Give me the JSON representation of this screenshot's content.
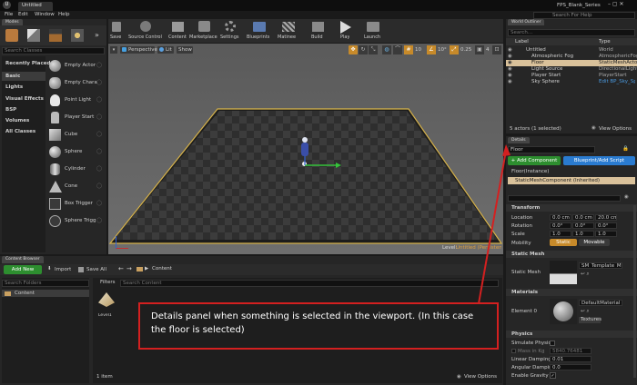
{
  "window": {
    "title": "Untitled",
    "project": "FPS_Blank_Series",
    "search_help": "Search For Help"
  },
  "menu": [
    "File",
    "Edit",
    "Window",
    "Help"
  ],
  "modes": {
    "title": "Modes",
    "search_placeholder": "Search Classes",
    "categories": [
      "Recently Placed",
      "Basic",
      "Lights",
      "Visual Effects",
      "BSP",
      "Volumes",
      "All Classes"
    ],
    "items": [
      "Empty Actor",
      "Empty Chara",
      "Point Light",
      "Player Start",
      "Cube",
      "Sphere",
      "Cylinder",
      "Cone",
      "Box Trigger",
      "Sphere Trigg"
    ]
  },
  "toolbar": [
    "Save",
    "Source Control",
    "Content",
    "Marketplace",
    "Settings",
    "Blueprints",
    "Matinee",
    "Build",
    "Play",
    "Launch"
  ],
  "viewport": {
    "perspective": "Perspective",
    "lit": "Lit",
    "show": "Show",
    "grid_snap": "10",
    "angle_snap": "10°",
    "scale_snap": "0.25",
    "cam_speed": "4",
    "level_label": "Level:",
    "level_name": "Untitled (Persistent)"
  },
  "outliner": {
    "title": "World Outliner",
    "search_placeholder": "Search...",
    "col_label": "Label",
    "col_type": "Type",
    "rows": [
      {
        "label": "Untitled",
        "type": "World"
      },
      {
        "label": "Atmospheric Fog",
        "type": "AtmosphericFog"
      },
      {
        "label": "Floor",
        "type": "StaticMeshActor"
      },
      {
        "label": "Light Source",
        "type": "DirectionalLight"
      },
      {
        "label": "Player Start",
        "type": "PlayerStart"
      },
      {
        "label": "Sky Sphere",
        "type": "Edit BP_Sky_Sp"
      }
    ],
    "status": "5 actors (1 selected)",
    "view_options": "View Options"
  },
  "details": {
    "title": "Details",
    "name": "Floor",
    "add_component": "+ Add Component",
    "blueprint_btn": "Blueprint/Add Script",
    "instance": "Floor(Instance)",
    "component": "StaticMeshComponent (Inherited)",
    "transform": {
      "title": "Transform",
      "location_label": "Location",
      "location": [
        "0.0 cm",
        "0.0 cm",
        "20.0 cm"
      ],
      "rotation_label": "Rotation",
      "rotation": [
        "0.0°",
        "0.0°",
        "0.0°"
      ],
      "scale_label": "Scale",
      "scale": [
        "1.0",
        "1.0",
        "1.0"
      ],
      "mobility_label": "Mobility",
      "static": "Static",
      "movable": "Movable"
    },
    "static_mesh": {
      "title": "Static Mesh",
      "label": "Static Mesh",
      "value": "SM_Template_Map"
    },
    "materials": {
      "title": "Materials",
      "label": "Element 0",
      "value": "DefaultMaterial",
      "textures": "Textures"
    },
    "physics": {
      "title": "Physics",
      "simulate": "Simulate Physics",
      "mass": "Mass in Kg",
      "mass_value": "5840.76481",
      "linear": "Linear Damping",
      "linear_value": "0.01",
      "angular": "Angular Damping",
      "angular_value": "0.0",
      "gravity": "Enable Gravity"
    }
  },
  "content_browser": {
    "title": "Content Browser",
    "add_new": "Add New",
    "import": "Import",
    "save_all": "Save All",
    "path": "Content",
    "search_folders": "Search Folders",
    "folder": "Content",
    "filters": "Filters",
    "search_content": "Search Content",
    "asset": "Level1",
    "count": "1 item",
    "view_options": "View Options"
  },
  "annotation": {
    "text": "Details panel when something is selected in the viewport. (In this case the floor is selected)"
  },
  "colors": {
    "accent_red": "#d42020",
    "selected": "#d9c19a",
    "add_green": "#2d8e2f",
    "bp_blue": "#2a7bd0"
  }
}
